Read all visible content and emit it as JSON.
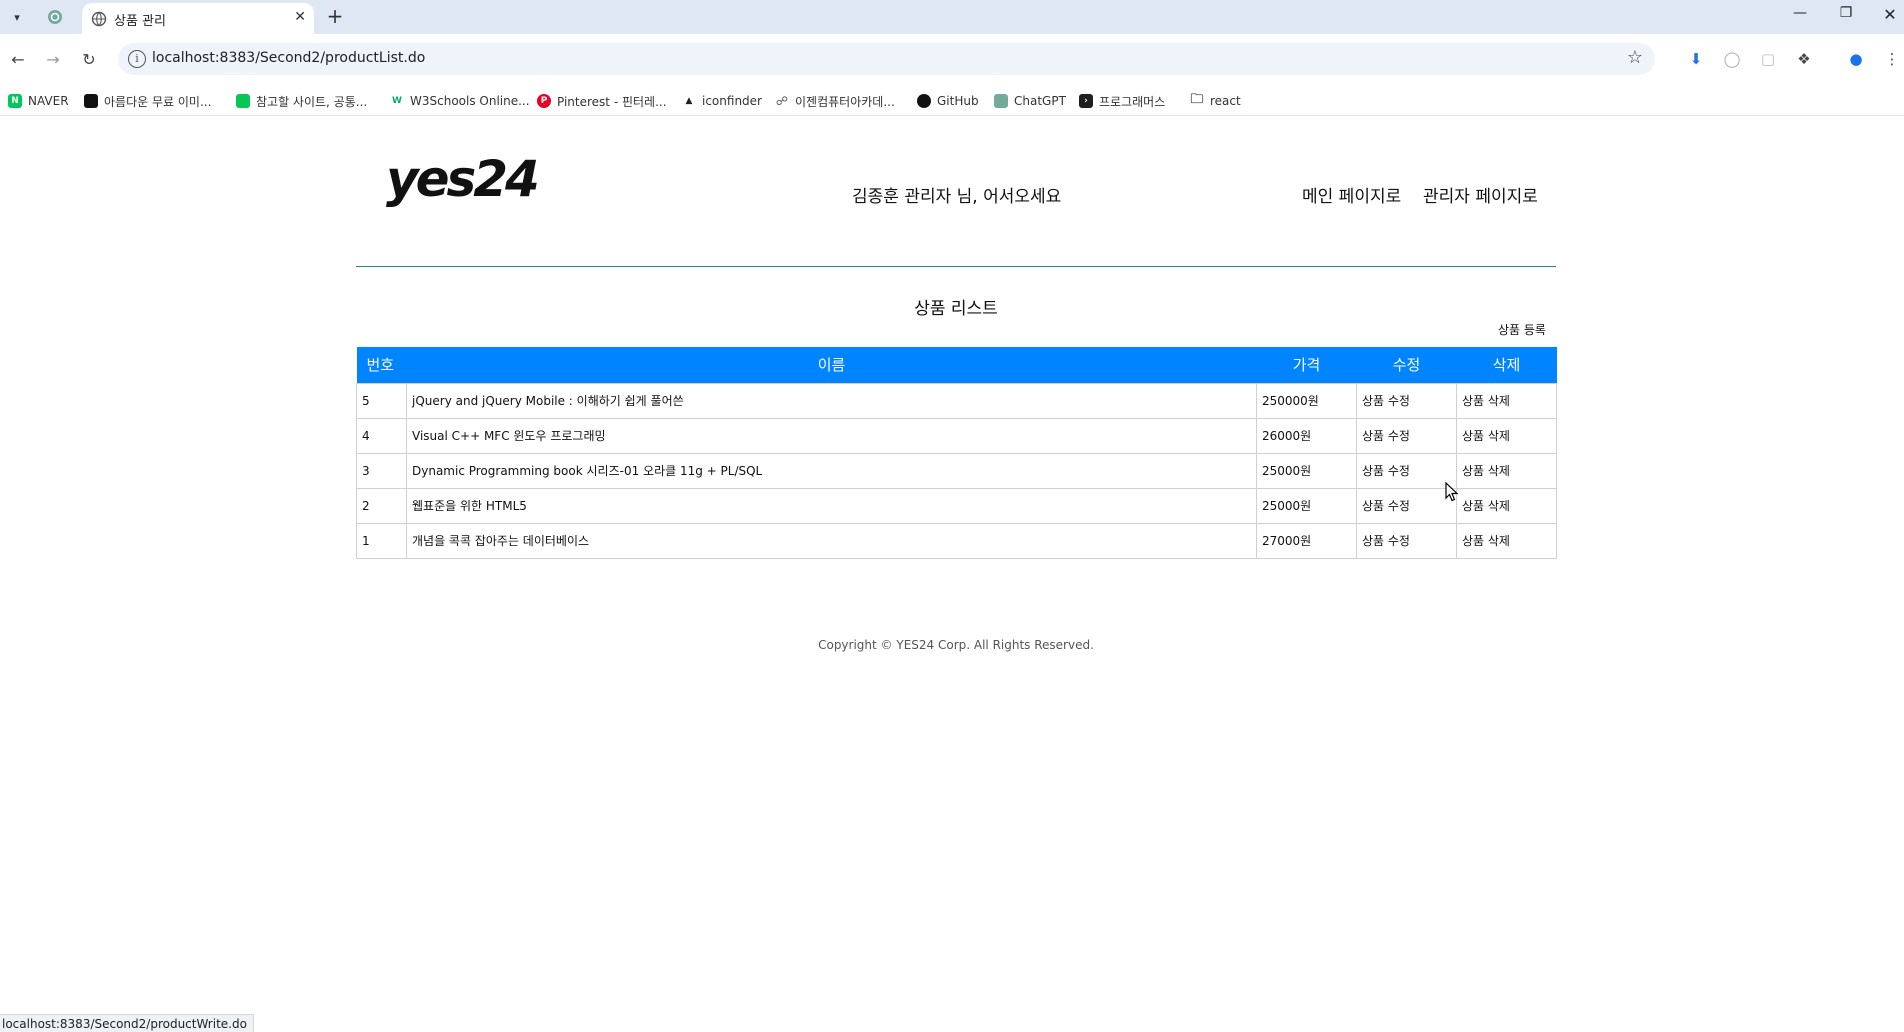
{
  "browser": {
    "active_tab_title": "상품 관리",
    "url": "localhost:8383/Second2/productList.do",
    "status_url": "localhost:8383/Second2/productWrite.do",
    "bookmarks": [
      {
        "label": "NAVER",
        "icon": "naver-icon",
        "color": "#03c75a"
      },
      {
        "label": "아름다운 무료 이미...",
        "icon": "unsplash-icon",
        "color": "#111111"
      },
      {
        "label": "참고할 사이트, 공통...",
        "icon": "line-icon",
        "color": "#06c755"
      },
      {
        "label": "W3Schools Online...",
        "icon": "w3schools-icon",
        "color": "#04aa6d"
      },
      {
        "label": "Pinterest - 핀터레...",
        "icon": "pinterest-icon",
        "color": "#e60023"
      },
      {
        "label": "iconfinder",
        "icon": "iconfinder-icon",
        "color": "#222222"
      },
      {
        "label": "이젠컴퓨터아카데...",
        "icon": "globe-icon",
        "color": "#555555"
      },
      {
        "label": "GitHub",
        "icon": "github-icon",
        "color": "#111111"
      },
      {
        "label": "ChatGPT",
        "icon": "chatgpt-icon",
        "color": "#74aa9c"
      },
      {
        "label": "프로그래머스",
        "icon": "programmers-icon",
        "color": "#1e1e23"
      },
      {
        "label": "react",
        "icon": "folder-icon",
        "color": "#555555"
      }
    ]
  },
  "header": {
    "logo": "yes24",
    "greeting": "김종훈 관리자 님, 어서오세요",
    "main_link": "메인 페이지로",
    "admin_link": "관리자 페이지로"
  },
  "main": {
    "title": "상품 리스트",
    "register_link": "상품 등록",
    "columns": [
      "번호",
      "이름",
      "가격",
      "수정",
      "삭제"
    ],
    "rows": [
      {
        "no": "5",
        "name": "jQuery and jQuery Mobile : 이해하기 쉽게 풀어쓴",
        "price": "250000원",
        "edit": "상품 수정",
        "delete": "상품 삭제"
      },
      {
        "no": "4",
        "name": "Visual C++ MFC 윈도우 프로그래밍",
        "price": "26000원",
        "edit": "상품 수정",
        "delete": "상품 삭제"
      },
      {
        "no": "3",
        "name": "Dynamic Programming book 시리즈-01 오라클 11g + PL/SQL",
        "price": "25000원",
        "edit": "상품 수정",
        "delete": "상품 삭제"
      },
      {
        "no": "2",
        "name": "웹표준을 위한 HTML5",
        "price": "25000원",
        "edit": "상품 수정",
        "delete": "상품 삭제"
      },
      {
        "no": "1",
        "name": "개념을 콕콕 잡아주는 데이터베이스",
        "price": "27000원",
        "edit": "상품 수정",
        "delete": "상품 삭제"
      }
    ]
  },
  "footer": {
    "copyright": "Copyright © YES24 Corp. All Rights Reserved."
  },
  "colors": {
    "table_header_bg": "#0084ff",
    "divider": "#2a7f9e",
    "tabstrip_bg": "#dfe7f5"
  }
}
